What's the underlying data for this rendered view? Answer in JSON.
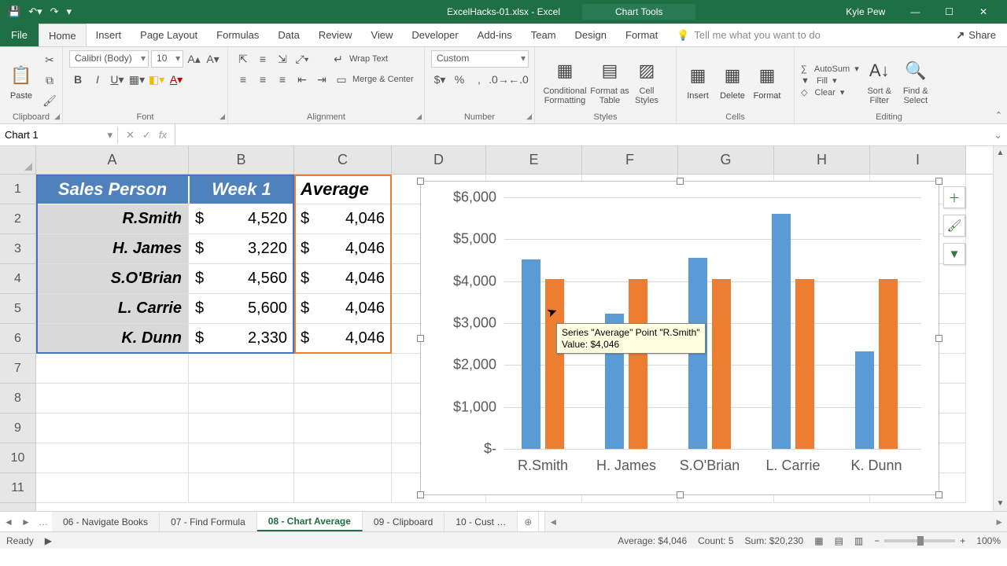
{
  "titlebar": {
    "filename": "ExcelHacks-01.xlsx - Excel",
    "charttools": "Chart Tools",
    "user": "Kyle Pew"
  },
  "tabs": {
    "file": "File",
    "home": "Home",
    "insert": "Insert",
    "pagelayout": "Page Layout",
    "formulas": "Formulas",
    "data": "Data",
    "review": "Review",
    "view": "View",
    "developer": "Developer",
    "addins": "Add-ins",
    "team": "Team",
    "design": "Design",
    "format": "Format",
    "tellme": "Tell me what you want to do",
    "share": "Share"
  },
  "ribbon": {
    "clipboard": {
      "label": "Clipboard",
      "paste": "Paste"
    },
    "font": {
      "label": "Font",
      "name": "Calibri (Body)",
      "size": "10"
    },
    "alignment": {
      "label": "Alignment",
      "wrap": "Wrap Text",
      "merge": "Merge & Center"
    },
    "number": {
      "label": "Number",
      "format": "Custom"
    },
    "styles": {
      "label": "Styles",
      "cond": "Conditional Formatting",
      "table": "Format as Table",
      "cell": "Cell Styles"
    },
    "cells": {
      "label": "Cells",
      "insert": "Insert",
      "delete": "Delete",
      "format": "Format"
    },
    "editing": {
      "label": "Editing",
      "autosum": "AutoSum",
      "fill": "Fill",
      "clear": "Clear",
      "sort": "Sort & Filter",
      "find": "Find & Select"
    }
  },
  "fx": {
    "namebox": "Chart 1"
  },
  "table": {
    "headers": [
      "Sales Person",
      "Week 1",
      "Average"
    ],
    "rows": [
      {
        "name": "R.Smith",
        "week1": "4,520",
        "avg": "4,046"
      },
      {
        "name": "H. James",
        "week1": "3,220",
        "avg": "4,046"
      },
      {
        "name": "S.O'Brian",
        "week1": "4,560",
        "avg": "4,046"
      },
      {
        "name": "L. Carrie",
        "week1": "5,600",
        "avg": "4,046"
      },
      {
        "name": "K. Dunn",
        "week1": "2,330",
        "avg": "4,046"
      }
    ]
  },
  "chart_data": {
    "type": "bar",
    "title": "",
    "xlabel": "",
    "ylabel": "",
    "ylim": [
      0,
      6000
    ],
    "yticks": [
      "$-",
      "$1,000",
      "$2,000",
      "$3,000",
      "$4,000",
      "$5,000",
      "$6,000"
    ],
    "categories": [
      "R.Smith",
      "H. James",
      "S.O'Brian",
      "L. Carrie",
      "K. Dunn"
    ],
    "series": [
      {
        "name": "Week 1",
        "color": "#5b9bd5",
        "values": [
          4520,
          3220,
          4560,
          5600,
          2330
        ]
      },
      {
        "name": "Average",
        "color": "#ed7d31",
        "values": [
          4046,
          4046,
          4046,
          4046,
          4046
        ]
      }
    ],
    "tooltip": {
      "line1": "Series \"Average\" Point \"R.Smith\"",
      "line2": "Value: $4,046"
    }
  },
  "sheets": {
    "items": [
      "06 - Navigate Books",
      "07 - Find Formula",
      "08 - Chart Average",
      "09 - Clipboard",
      "10 - Cust …"
    ],
    "active_index": 2
  },
  "statusbar": {
    "ready": "Ready",
    "avg": "Average: $4,046",
    "count": "Count: 5",
    "sum": "Sum: $20,230",
    "zoom": "100%"
  },
  "columns": [
    "A",
    "B",
    "C",
    "D",
    "E",
    "F",
    "G",
    "H",
    "I"
  ],
  "rownums": [
    "1",
    "2",
    "3",
    "4",
    "5",
    "6",
    "7",
    "8",
    "9",
    "10",
    "11"
  ]
}
